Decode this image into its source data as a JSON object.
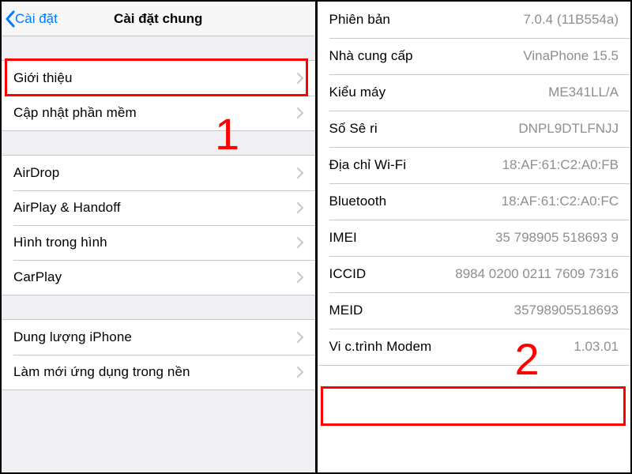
{
  "left": {
    "back_label": "Cài đặt",
    "title": "Cài đặt chung",
    "group1": [
      {
        "label": "Giới thiệu"
      },
      {
        "label": "Cập nhật phần mềm"
      }
    ],
    "group2": [
      {
        "label": "AirDrop"
      },
      {
        "label": "AirPlay & Handoff"
      },
      {
        "label": "Hình trong hình"
      },
      {
        "label": "CarPlay"
      }
    ],
    "group3": [
      {
        "label": "Dung lượng iPhone"
      },
      {
        "label": "Làm mới ứng dụng trong nền"
      }
    ],
    "annotation_number": "1"
  },
  "right": {
    "rows": [
      {
        "label": "Phiên bản",
        "value": "7.0.4 (11B554a)"
      },
      {
        "label": "Nhà cung cấp",
        "value": "VinaPhone 15.5"
      },
      {
        "label": "Kiểu máy",
        "value": "ME341LL/A"
      },
      {
        "label": "Số Sê ri",
        "value": "DNPL9DTLFNJJ"
      },
      {
        "label": "Địa chỉ Wi-Fi",
        "value": "18:AF:61:C2:A0:FB"
      },
      {
        "label": "Bluetooth",
        "value": "18:AF:61:C2:A0:FC"
      },
      {
        "label": "IMEI",
        "value": "35 798905 518693 9"
      },
      {
        "label": "ICCID",
        "value": "8984 0200 0211 7609 7316"
      },
      {
        "label": "MEID",
        "value": "35798905518693"
      },
      {
        "label": "Vi c.trình Modem",
        "value": "1.03.01"
      }
    ],
    "annotation_number": "2"
  }
}
